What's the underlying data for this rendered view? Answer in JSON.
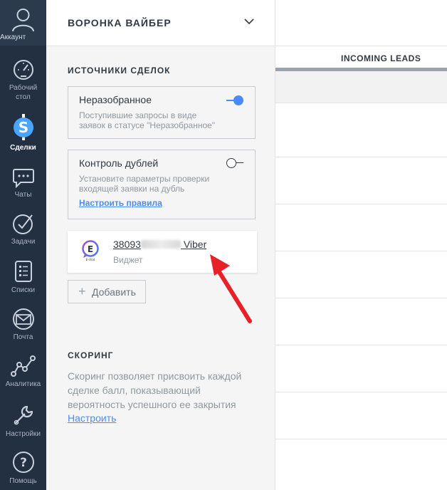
{
  "nav": {
    "account": "Аккаунт",
    "items": [
      {
        "label": "Рабочий стол",
        "icon": "dashboard-icon"
      },
      {
        "label": "Сделки",
        "icon": "deals-icon"
      },
      {
        "label": "Чаты",
        "icon": "chat-icon"
      },
      {
        "label": "Задачи",
        "icon": "tasks-icon"
      },
      {
        "label": "Списки",
        "icon": "lists-icon"
      },
      {
        "label": "Почта",
        "icon": "mail-icon"
      },
      {
        "label": "Аналитика",
        "icon": "analytics-icon"
      },
      {
        "label": "Настройки",
        "icon": "settings-icon"
      },
      {
        "label": "Помощь",
        "icon": "help-icon"
      }
    ],
    "active": "Сделки"
  },
  "panel": {
    "title": "ВОРОНКА ВАЙБЕР",
    "sources_title": "ИСТОЧНИКИ СДЕЛОК",
    "unsorted": {
      "title": "Неразобранное",
      "desc": "Поступившие запросы в виде заявок в статусе \"Неразобранное\"",
      "enabled": true
    },
    "duplicates": {
      "title": "Контроль дублей",
      "desc": "Установите параметры проверки входящей заявки на дубль",
      "link": "Настроить правила",
      "enabled": false
    },
    "widget": {
      "name_prefix": "38093",
      "name_suffix": " Viber",
      "subtitle": "Виджет",
      "logo_letter": "E",
      "logo_caption": "E-chat"
    },
    "add_button": "Добавить",
    "scoring": {
      "title": "СКОРИНГ",
      "desc": "Скоринг позволяет присвоить каждой сделке балл, показывающий вероятность успешного ее закрытия",
      "link": "Настроить"
    }
  },
  "board": {
    "column_title": "INCOMING LEADS"
  },
  "colors": {
    "nav_bg": "#233041",
    "accent": "#4c8bf7",
    "arrow": "#e8202a"
  }
}
